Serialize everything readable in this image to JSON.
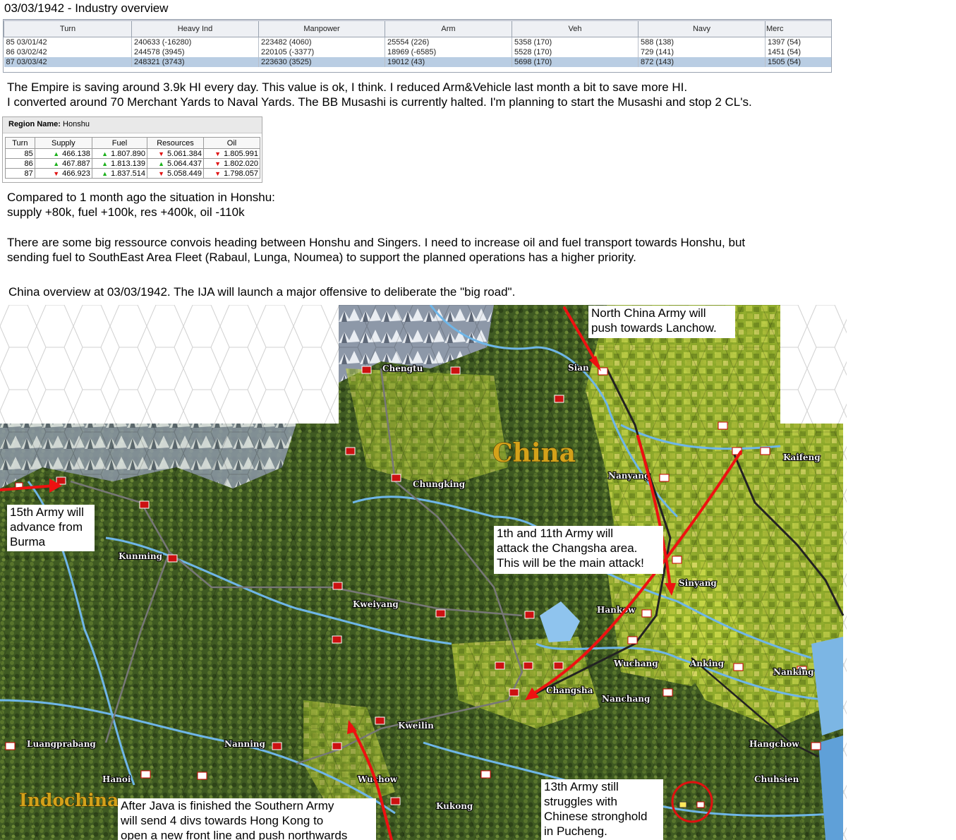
{
  "title": "03/03/1942 - Industry overview",
  "industry": {
    "headers": [
      "Turn",
      "Heavy Ind",
      "Manpower",
      "Arm",
      "Veh",
      "Navy",
      "Merc"
    ],
    "rows": [
      [
        "85   03/01/42",
        "240633   (-16280)",
        "223482   (4060)",
        "25554   (226)",
        "5358   (170)",
        "588   (138)",
        "1397   (54)"
      ],
      [
        "86   03/02/42",
        "244578   (3945)",
        "220105   (-3377)",
        "18969   (-6585)",
        "5528   (170)",
        "729   (141)",
        "1451   (54)"
      ],
      [
        "87   03/03/42",
        "248321   (3743)",
        "223630   (3525)",
        "19012   (43)",
        "5698   (170)",
        "872   (143)",
        "1505   (54)"
      ]
    ]
  },
  "para1": {
    "line1": "The Empire is saving around 3.9k HI every day. This value is ok, I think. I reduced Arm&Vehicle last month a bit to save more HI.",
    "line2": "I converted around 70 Merchant Yards to Naval Yards. The BB Musashi is currently halted. I'm planning to start the Musashi and stop 2 CL's."
  },
  "region": {
    "label": "Region Name:",
    "name": "Honshu",
    "headers": [
      "Turn",
      "Supply",
      "Fuel",
      "Resources",
      "Oil"
    ],
    "rows": [
      {
        "turn": "85",
        "supply": "466.138",
        "supply_dir": "up",
        "fuel": "1.807.890",
        "fuel_dir": "up",
        "res": "5.061.384",
        "res_dir": "down",
        "oil": "1.805.991",
        "oil_dir": "down"
      },
      {
        "turn": "86",
        "supply": "467.887",
        "supply_dir": "up",
        "fuel": "1.813.139",
        "fuel_dir": "up",
        "res": "5.064.437",
        "res_dir": "up",
        "oil": "1.802.020",
        "oil_dir": "down"
      },
      {
        "turn": "87",
        "supply": "466.923",
        "supply_dir": "down",
        "fuel": "1.837.514",
        "fuel_dir": "up",
        "res": "5.058.449",
        "res_dir": "down",
        "oil": "1.798.057",
        "oil_dir": "down"
      }
    ]
  },
  "para2": {
    "line1": "Compared to 1 month ago the situation in Honshu:",
    "line2": "supply +80k, fuel +100k, res +400k, oil -110k"
  },
  "para3": {
    "line1": "There are some big ressource convois heading between Honshu and Singers. I need to increase oil and fuel transport towards Honshu, but",
    "line2": "sending fuel to SouthEast Area Fleet (Rabaul, Lunga, Noumea) to support the planned operations has a higher priority."
  },
  "para4": "China overview at 03/03/1942. The IJA will launch a major offensive to deliberate the \"big road\".",
  "map": {
    "region_labels": [
      "China",
      "Indochina"
    ],
    "cities": [
      "Chengtu",
      "Sian",
      "Chungking",
      "Nanyang",
      "Kaifeng",
      "Kunming",
      "Kweiyang",
      "Sinyang",
      "Hankow",
      "Wuchang",
      "Anking",
      "Nanking",
      "Changsha",
      "Nanchang",
      "Kweilin",
      "Nanning",
      "Luangprabang",
      "Hanoi",
      "Wuchow",
      "Kukong",
      "Hangchow",
      "Chuhsien"
    ],
    "callouts": {
      "north": [
        "North China Army will",
        "push towards Lanchow."
      ],
      "burma": [
        "15th Army will",
        "advance from",
        "Burma"
      ],
      "changsha": [
        "1th and 11th Army will",
        "attack the Changsha area.",
        "This will be the main attack!"
      ],
      "south": [
        "After Java is finished the Southern Army",
        "will send 4 divs towards Hong Kong to",
        "open a new front line and push northwards"
      ],
      "thirteenth": [
        "13th Army still",
        "struggles with",
        "Chinese stronghold",
        "in Pucheng."
      ]
    }
  }
}
